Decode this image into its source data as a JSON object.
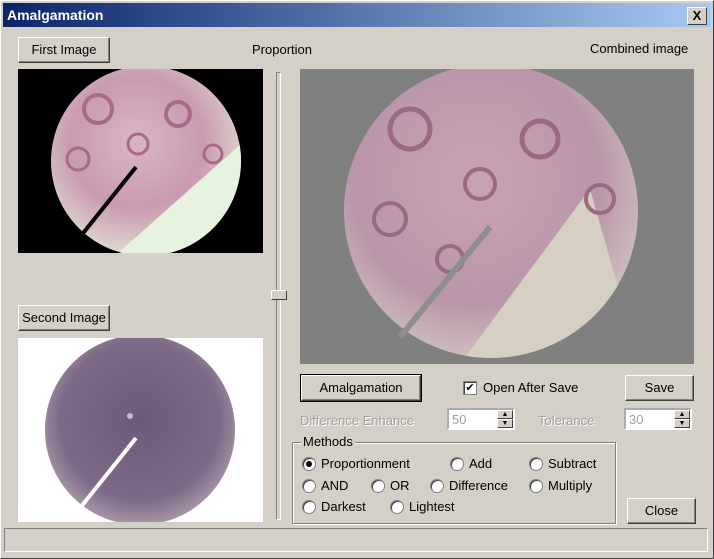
{
  "window": {
    "title": "Amalgamation",
    "close_glyph": "X"
  },
  "buttons": {
    "first_image": "First Image",
    "second_image": "Second Image",
    "amalgamation": "Amalgamation",
    "save": "Save",
    "close": "Close"
  },
  "labels": {
    "proportion": "Proportion",
    "combined_image": "Combined image",
    "difference_enhance": "Difference Enhance",
    "tolerance": "Tolerance"
  },
  "open_after_save": {
    "label": "Open After Save",
    "checked": true
  },
  "spinners": {
    "difference_enhance": "50",
    "tolerance": "30"
  },
  "methods": {
    "label": "Methods",
    "selected": "Proportionment",
    "options": [
      "Proportionment",
      "Add",
      "Subtract",
      "AND",
      "OR",
      "Difference",
      "Multiply",
      "Darkest",
      "Lightest"
    ]
  },
  "colors": {
    "titlebar_start": "#0a246a",
    "titlebar_end": "#a6caf0",
    "dialog_bg": "#d4d0c8",
    "combined_bg": "#808080"
  }
}
